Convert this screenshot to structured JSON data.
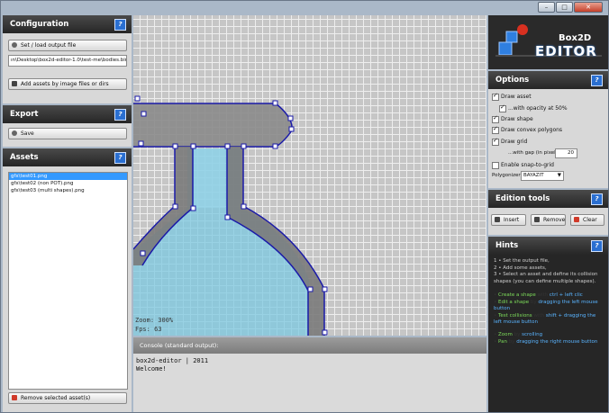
{
  "window": {
    "controls": [
      "–",
      "□",
      "✕"
    ]
  },
  "config": {
    "title": "Configuration",
    "set_output_label": "Set / load output file",
    "output_path": "ın\\Desktop\\box2d-editor-1.0\\test-me\\bodies.bin",
    "add_assets_label": "Add assets by image files or dirs"
  },
  "export": {
    "title": "Export",
    "save_label": "Save"
  },
  "assets": {
    "title": "Assets",
    "items": [
      "gfx\\test01.png",
      "gfx\\test02 (non POT).png",
      "gfx\\test03 (multi shapes).png"
    ],
    "remove_label": "Remove selected asset(s)"
  },
  "canvas": {
    "zoom": "Zoom: 300%",
    "fps": "Fps: 63"
  },
  "console": {
    "title": "Console (standard output):",
    "lines": [
      "box2d-editor | 2011",
      "Welcome!"
    ]
  },
  "logo": {
    "top": "Box2D",
    "bottom": "EDITOR"
  },
  "options": {
    "title": "Options",
    "draw_asset": "Draw asset",
    "with_opacity": "...with opacity at 50%",
    "draw_shape": "Draw shape",
    "draw_convex": "Draw convex polygons",
    "draw_grid": "Draw grid",
    "gap_label": "...with gap (in pixels):",
    "gap_value": "20",
    "snap": "Enable snap-to-grid",
    "polygonizer_label": "Polygonizer:",
    "polygonizer_value": "BAYAZIT"
  },
  "edition": {
    "title": "Edition tools",
    "insert": "Insert",
    "remove": "Remove",
    "clear": "Clear"
  },
  "hints": {
    "title": "Hints",
    "l1": "1 • Set the output file,",
    "l2": "2 • Add some assets,",
    "l3": "3 • Select an asset and define its collision shapes (you can define multiple shapes).",
    "create_a": "Create a shape",
    "create_b": " with ",
    "create_c": "ctrl + left clic",
    "edit_a": "Edit a shape",
    "edit_b": " by ",
    "edit_c": "dragging the left mouse button",
    "test_a": "Test collisions",
    "test_b": " with ",
    "test_c": "shift + dragging the left mouse button",
    "zoom_a": "Zoom",
    "zoom_b": " by ",
    "zoom_c": "scrolling",
    "pan_a": "Pan",
    "pan_b": " by ",
    "pan_c": "dragging the right mouse button"
  },
  "colors": {
    "accent": "#2a6fd1",
    "selection": "#3399ff",
    "shape": "#1a1aa8",
    "glass": "#7cc8e0"
  }
}
